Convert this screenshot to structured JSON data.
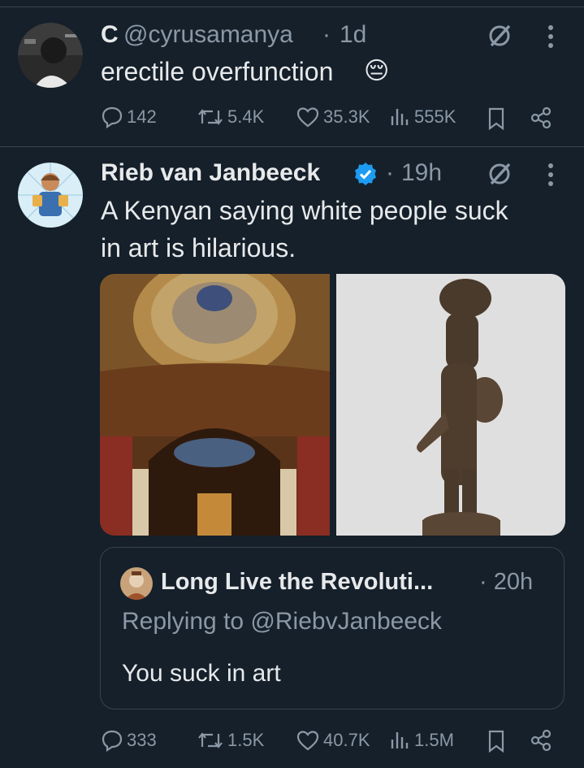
{
  "colors": {
    "background": "#15202b",
    "text": "#e7e9ea",
    "muted": "#8b98a5",
    "border": "#38444d",
    "verified": "#1d9bf0"
  },
  "tweets": [
    {
      "display_name": "C",
      "handle": "@cyrusamanya",
      "separator": "·",
      "time": "1d",
      "text": "erectile overfunction",
      "emoji": "😔",
      "stats": {
        "replies": "142",
        "reposts": "5.4K",
        "likes": "35.3K",
        "views": "555K"
      }
    },
    {
      "display_name": "Rieb van Janbeeck",
      "verified": true,
      "separator": "·",
      "time": "19h",
      "text_line1": "A Kenyan saying white people suck",
      "text_line2": "in art is hilarious.",
      "media": [
        "cathedral-dome-interior-photo",
        "wooden-figure-sculpture-photo"
      ],
      "quote": {
        "display_name": "Long Live the Revoluti...",
        "separator": "·",
        "time": "20h",
        "replying": "Replying to @RiebvJanbeeck",
        "text": "You suck in art"
      },
      "stats": {
        "replies": "333",
        "reposts": "1.5K",
        "likes": "40.7K",
        "views": "1.5M"
      }
    }
  ],
  "icons": [
    "grok-icon",
    "more-icon",
    "reply-icon",
    "repost-icon",
    "like-icon",
    "views-icon",
    "bookmark-icon",
    "share-icon",
    "verified-badge-icon"
  ]
}
